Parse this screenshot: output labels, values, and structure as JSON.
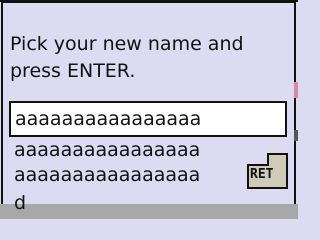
{
  "dialog": {
    "prompt": "Pick your new name and\npress ENTER."
  },
  "name_entry": {
    "lines": [
      "aaaaaaaaaaaaaaaa",
      "aaaaaaaaaaaaaaaa",
      "aaaaaaaaaaaaaaaa",
      "d"
    ]
  },
  "enter_key": {
    "label": "RET",
    "icon": "return-key-icon"
  },
  "colors": {
    "window_background": "#dddbf2",
    "input_background": "#ffffff",
    "border": "#111111",
    "bottom_bar": "#a8a8a8",
    "edge_pink": "#d98aa3"
  }
}
